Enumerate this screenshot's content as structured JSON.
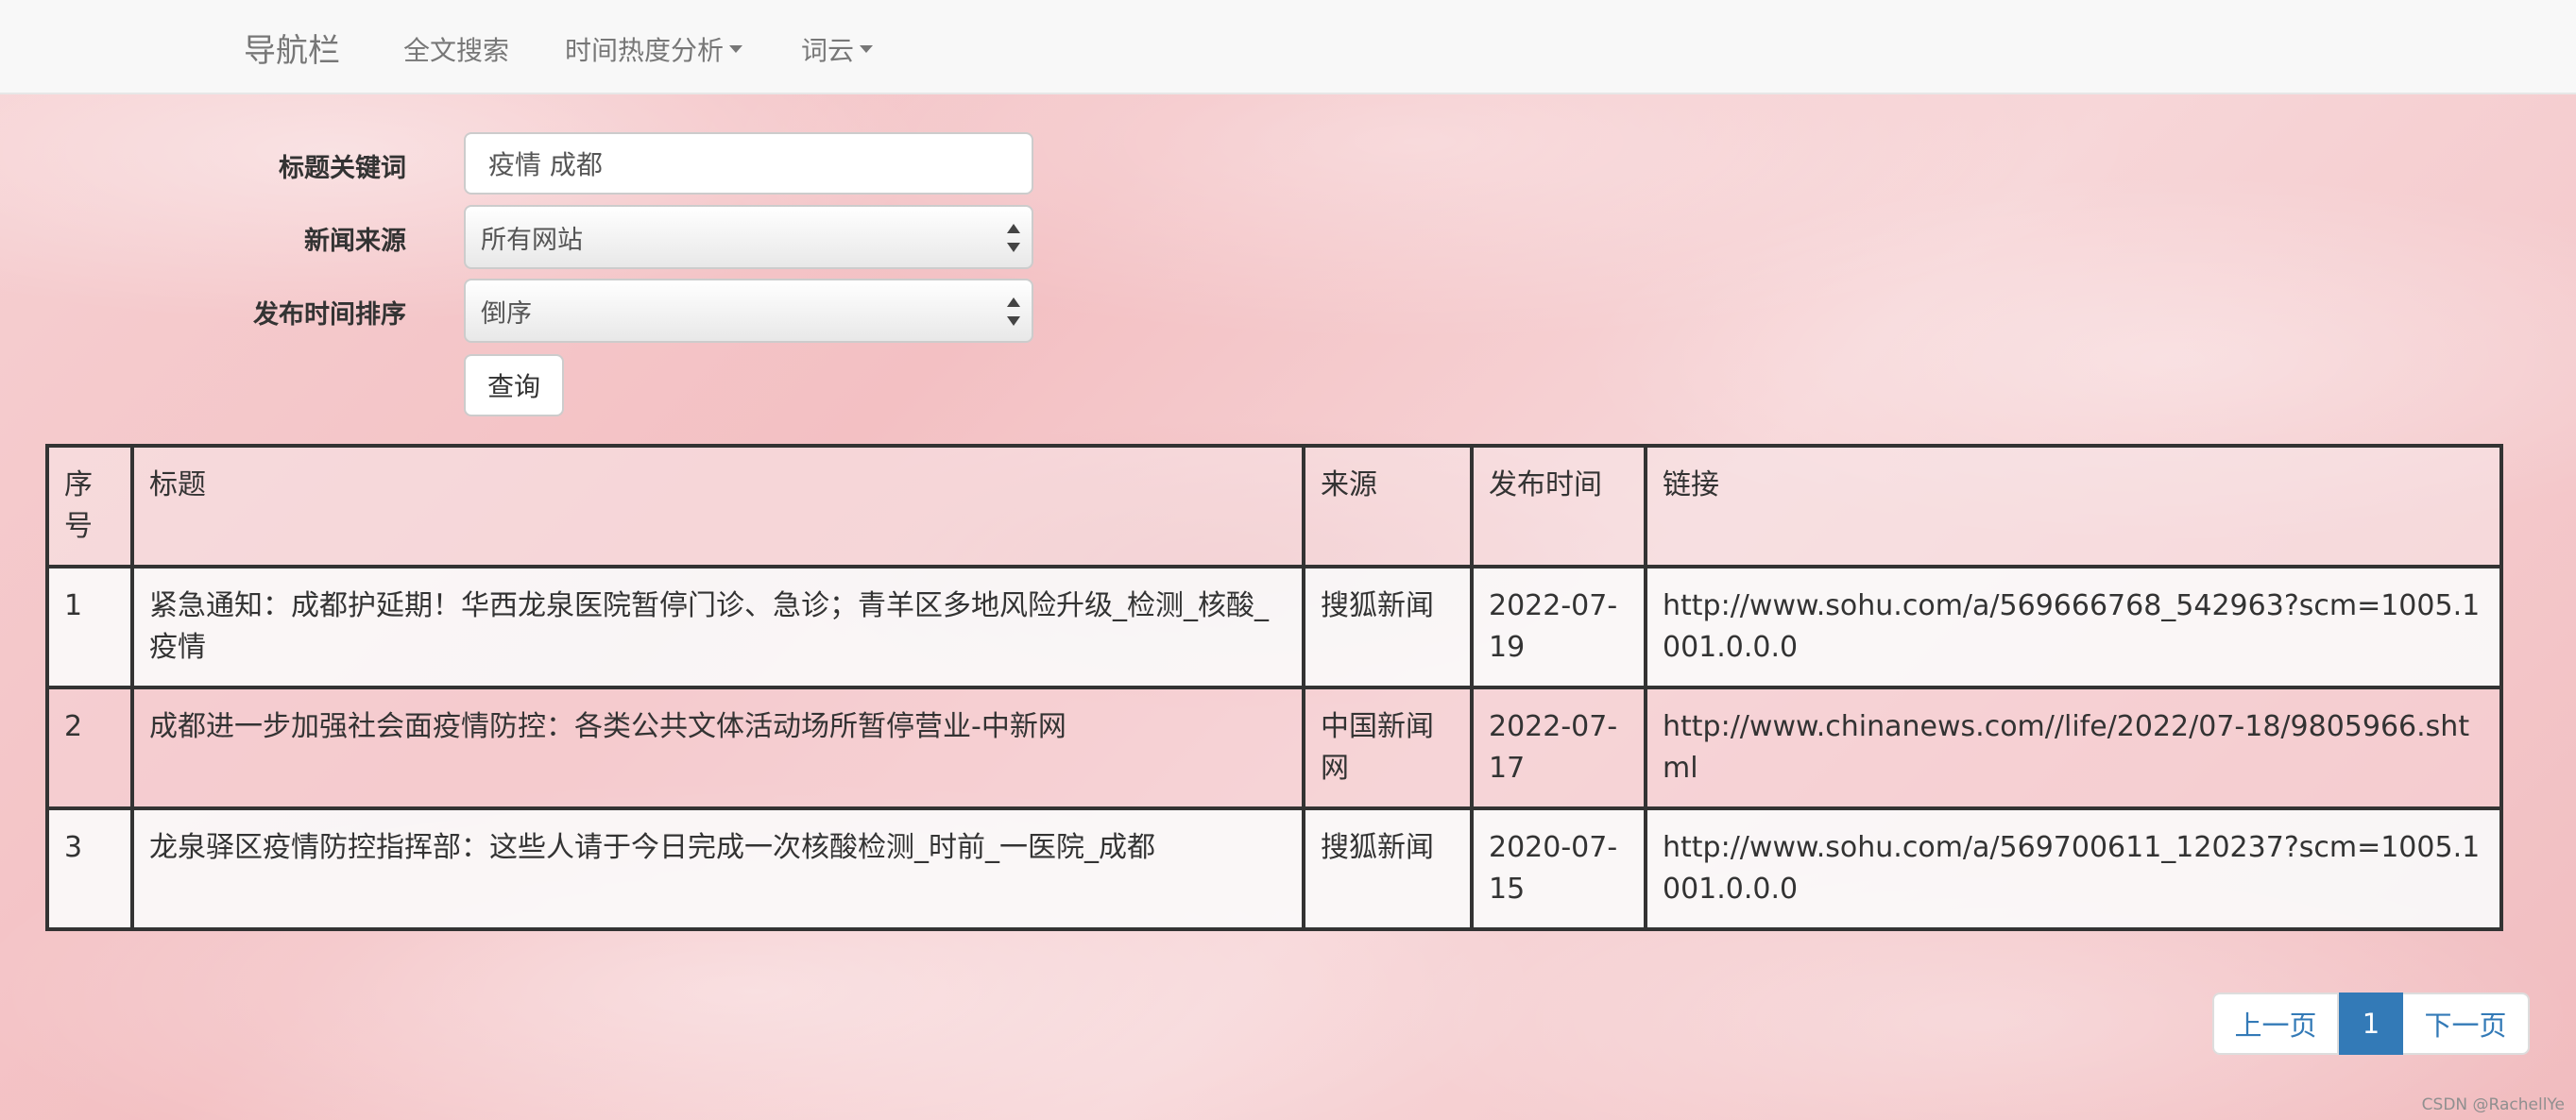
{
  "navbar": {
    "brand": "导航栏",
    "items": [
      {
        "label": "全文搜索"
      },
      {
        "label": "时间热度分析"
      },
      {
        "label": "词云"
      }
    ]
  },
  "form": {
    "keyword_label": "标题关键词",
    "keyword_value": "疫情 成都",
    "source_label": "新闻来源",
    "source_selected": "所有网站",
    "order_label": "发布时间排序",
    "order_selected": "倒序",
    "submit_label": "查询"
  },
  "table": {
    "headers": [
      "序号",
      "标题",
      "来源",
      "发布时间",
      "链接"
    ],
    "rows": [
      {
        "index": "1",
        "title": "紧急通知：成都护延期！华西龙泉医院暂停门诊、急诊；青羊区多地风险升级_检测_核酸_疫情",
        "source": "搜狐新闻",
        "date": "2022-07-19",
        "link": "http://www.sohu.com/a/569666768_542963?scm=1005.1001.0.0.0"
      },
      {
        "index": "2",
        "title": "成都进一步加强社会面疫情防控：各类公共文体活动场所暂停营业-中新网",
        "source": "中国新闻网",
        "date": "2022-07-17",
        "link": "http://www.chinanews.com//life/2022/07-18/9805966.shtml"
      },
      {
        "index": "3",
        "title": "龙泉驿区疫情防控指挥部：这些人请于今日完成一次核酸检测_时前_一医院_成都",
        "source": "搜狐新闻",
        "date": "2020-07-15",
        "link": "http://www.sohu.com/a/569700611_120237?scm=1005.1001.0.0.0"
      }
    ]
  },
  "pagination": {
    "prev": "上一页",
    "current": "1",
    "next": "下一页"
  },
  "watermark": "CSDN @RachellYe",
  "colors": {
    "primary": "#337ab7",
    "navbar_bg": "#f8f8f8",
    "background": "#f5c9cc"
  },
  "icons": {
    "dropdown": "caret-down-icon",
    "select": "select-arrows-icon"
  }
}
